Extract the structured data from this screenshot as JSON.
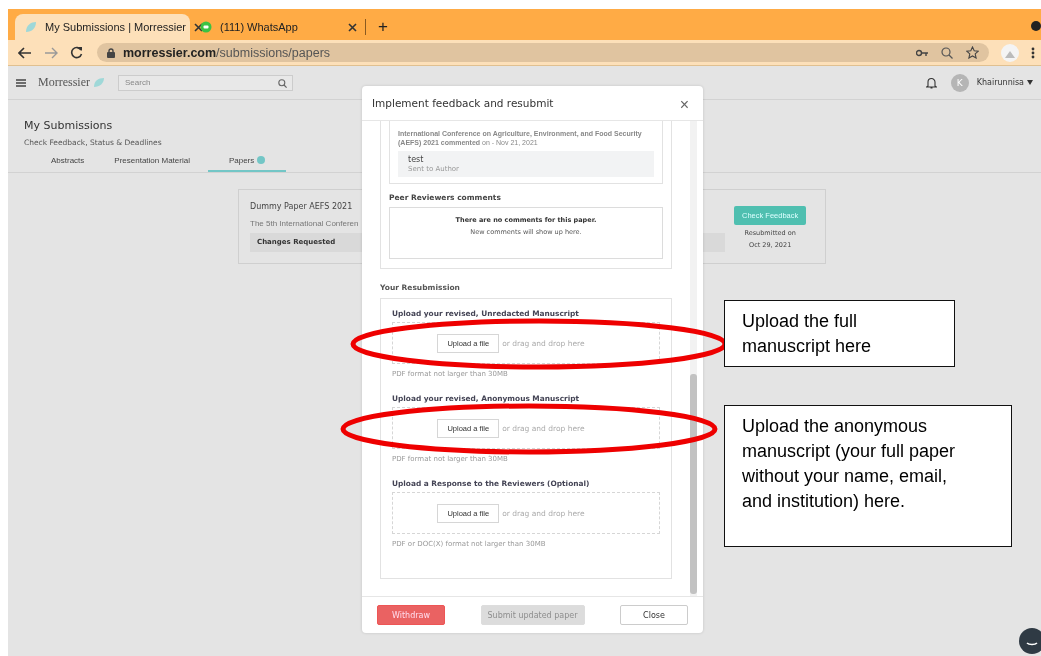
{
  "browser": {
    "tabs": [
      {
        "title": "My Submissions | Morressier",
        "selected": true
      },
      {
        "title": "(111) WhatsApp",
        "selected": false
      }
    ],
    "new_tab": "+",
    "url_host": "morressier.com",
    "url_path": "/submissions/papers"
  },
  "header": {
    "logo": "Morressier",
    "search_placeholder": "Search",
    "avatar_initial": "K",
    "user_name": "Khairunnisa"
  },
  "page": {
    "title": "My Submissions",
    "subtitle": "Check Feedback, Status & Deadlines",
    "tabs": [
      {
        "label": "Abstracts",
        "selected": false,
        "badge": false
      },
      {
        "label": "Presentation Material",
        "selected": false,
        "badge": false
      },
      {
        "label": "Papers",
        "selected": true,
        "badge": true
      }
    ]
  },
  "submission": {
    "title": "Dummy Paper AEFS 2021",
    "event": "The 5th International Conferen",
    "status": "Changes Requested",
    "action": "Check Feedback",
    "resubmitted_label": "Resubmitted on",
    "resubmitted_date": "Oct 29, 2021"
  },
  "modal": {
    "title": "Implement feedback and resubmit",
    "close": "×",
    "comment": {
      "header": "**International Conference on Agriculture, Environment, and Food Security (AEFS) 2021 commented** on - Nov 21, 2021",
      "text": "test",
      "status": "Sent to Author"
    },
    "peer_heading": "Peer Reviewers comments",
    "peer_empty": "There are no comments for this paper.",
    "peer_empty_hint": "New comments will show up here.",
    "resubmission_heading": "Your Resubmission",
    "uploads": [
      {
        "label": "Upload your revised, Unredacted Manuscript",
        "button": "Upload a file",
        "drop_hint": "or drag and drop here",
        "help": "PDF format not larger than 30MB"
      },
      {
        "label": "Upload your revised, Anonymous Manuscript",
        "button": "Upload a file",
        "drop_hint": "or drag and drop here",
        "help": "PDF format not larger than 30MB"
      },
      {
        "label": "Upload a Response to the Reviewers (Optional)",
        "button": "Upload a file",
        "drop_hint": "or drag and drop here",
        "help": "PDF or DOC(X) format not larger than 30MB"
      }
    ],
    "buttons": [
      {
        "label": "Withdraw",
        "kind": "danger",
        "disabled": false
      },
      {
        "label": "Submit updated paper",
        "kind": "primary",
        "disabled": true
      },
      {
        "label": "Close",
        "kind": "plain",
        "disabled": false
      }
    ]
  },
  "annotations": [
    {
      "kind": "ellipse"
    },
    {
      "kind": "ellipse"
    },
    {
      "kind": "callout",
      "text": "Upload the full manuscript here"
    },
    {
      "kind": "callout",
      "text": "Upload the anonymous manuscript (your full paper without your name, email, and institution) here."
    }
  ]
}
